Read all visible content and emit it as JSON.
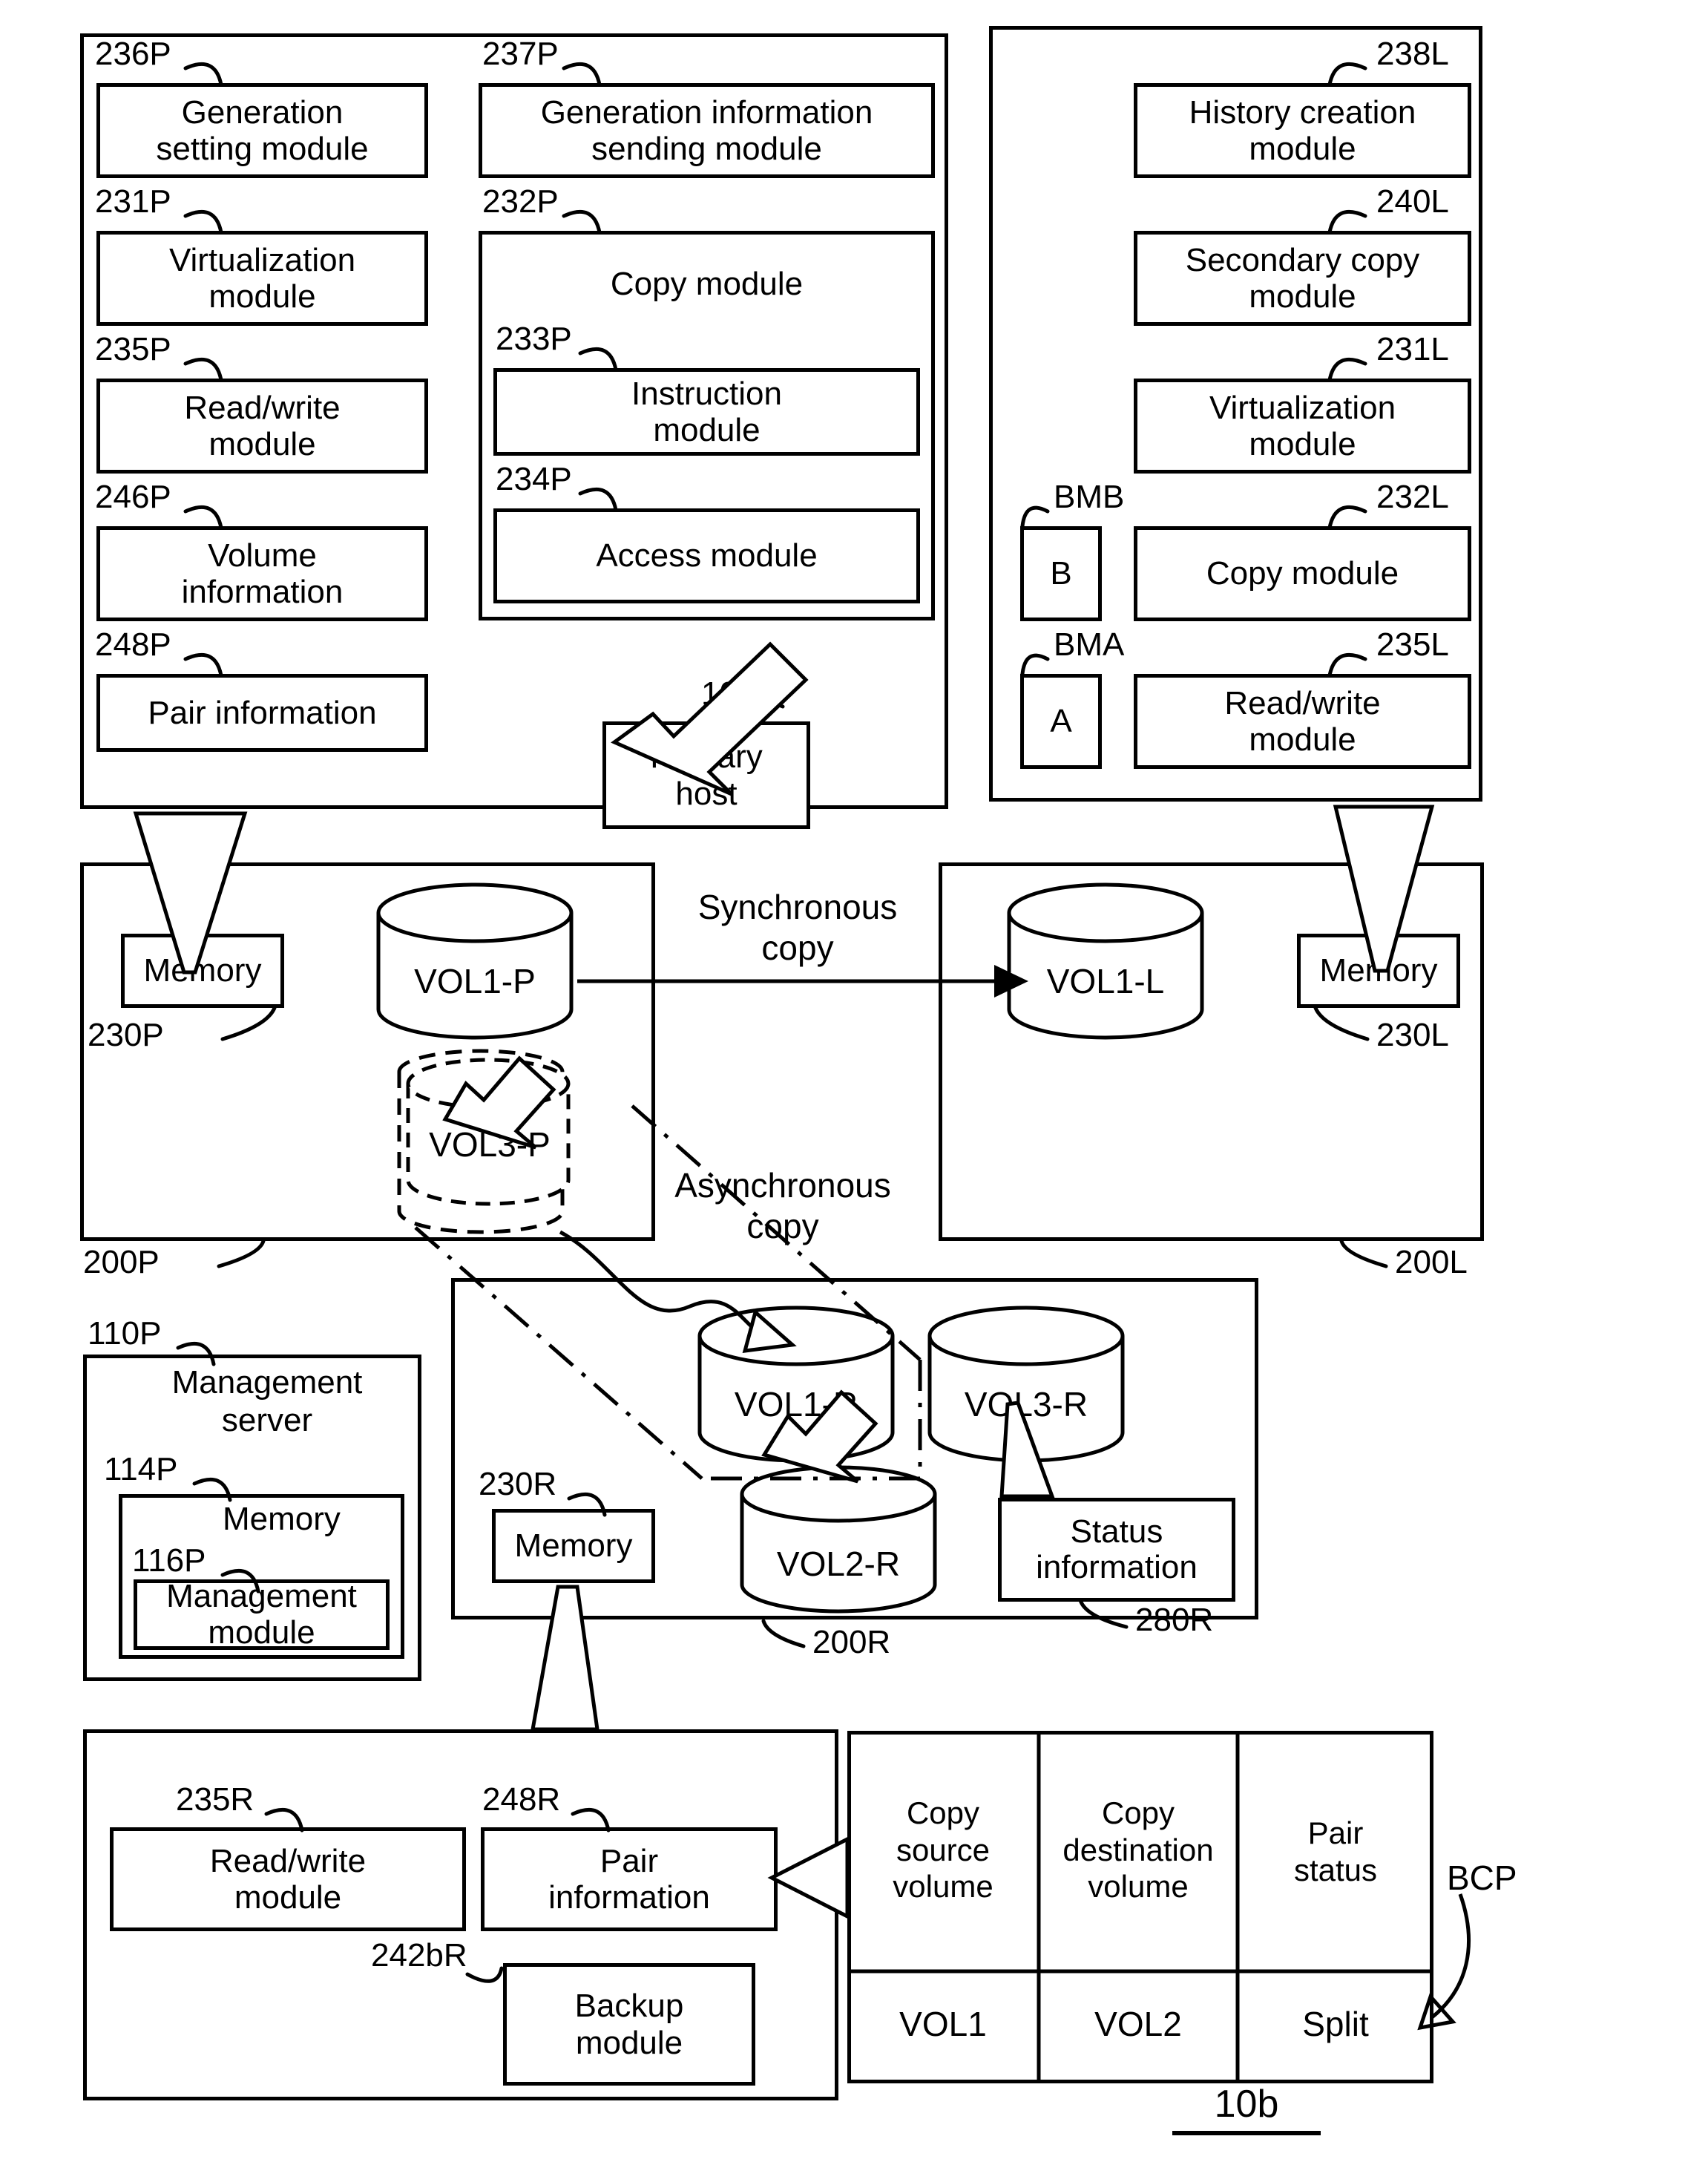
{
  "figure": {
    "id": "10b"
  },
  "primary_memory_panel": {
    "ref": "230P-contents",
    "left_column": [
      {
        "ref": "236P",
        "label": "Generation\nsetting module"
      },
      {
        "ref": "231P",
        "label": "Virtualization\nmodule"
      },
      {
        "ref": "235P",
        "label": "Read/write\nmodule"
      },
      {
        "ref": "246P",
        "label": "Volume\ninformation"
      },
      {
        "ref": "248P",
        "label": "Pair information"
      }
    ],
    "right_column": {
      "gen_info": {
        "ref": "237P",
        "label": "Generation information\nsending module"
      },
      "copy_module": {
        "ref": "232P",
        "label": "Copy module",
        "children": [
          {
            "ref": "233P",
            "label": "Instruction\nmodule"
          },
          {
            "ref": "234P",
            "label": "Access module"
          }
        ]
      }
    }
  },
  "local_memory_panel": {
    "items": [
      {
        "ref": "238L",
        "label": "History creation\nmodule"
      },
      {
        "ref": "240L",
        "label": "Secondary copy\nmodule"
      },
      {
        "ref": "231L",
        "label": "Virtualization\nmodule"
      }
    ],
    "bitmap_rows": [
      {
        "bm_ref": "BMB",
        "bm_label": "B",
        "ref": "232L",
        "label": "Copy module"
      },
      {
        "bm_ref": "BMA",
        "bm_label": "A",
        "ref": "235L",
        "label": "Read/write\nmodule"
      }
    ]
  },
  "primary_host": {
    "ref": "100P",
    "label": "Primary\nhost"
  },
  "storage_primary": {
    "ref": "200P",
    "memory": {
      "ref": "230P",
      "label": "Memory"
    },
    "volumes": [
      {
        "name": "VOL1-P",
        "style": "solid"
      },
      {
        "name": "VOL3-P",
        "style": "dashed"
      }
    ]
  },
  "storage_local": {
    "ref": "200L",
    "memory": {
      "ref": "230L",
      "label": "Memory"
    },
    "volumes": [
      {
        "name": "VOL1-L",
        "style": "solid"
      }
    ]
  },
  "storage_remote": {
    "ref": "200R",
    "memory": {
      "ref": "230R",
      "label": "Memory"
    },
    "volumes": [
      {
        "name": "VOL1-R",
        "style": "solid"
      },
      {
        "name": "VOL3-R",
        "style": "solid"
      },
      {
        "name": "VOL2-R",
        "style": "solid"
      }
    ],
    "status_information": {
      "ref": "280R",
      "label": "Status\ninformation"
    }
  },
  "management_server": {
    "ref": "110P",
    "title": "Management\nserver",
    "memory": {
      "ref": "114P",
      "label": "Memory"
    },
    "module": {
      "ref": "116P",
      "label": "Management\nmodule"
    }
  },
  "remote_memory_panel": {
    "items": [
      {
        "ref": "235R",
        "label": "Read/write\nmodule"
      },
      {
        "ref": "248R",
        "label": "Pair\ninformation"
      },
      {
        "ref": "242bR",
        "label": "Backup\nmodule"
      }
    ]
  },
  "pair_table": {
    "ref": "BCP",
    "headers": [
      "Copy\nsource\nvolume",
      "Copy\ndestination\nvolume",
      "Pair\nstatus"
    ],
    "rows": [
      [
        "VOL1",
        "VOL2",
        "Split"
      ]
    ]
  },
  "annotations": {
    "synchronous_copy": "Synchronous\ncopy",
    "asynchronous_copy": "Asynchronous\ncopy"
  }
}
